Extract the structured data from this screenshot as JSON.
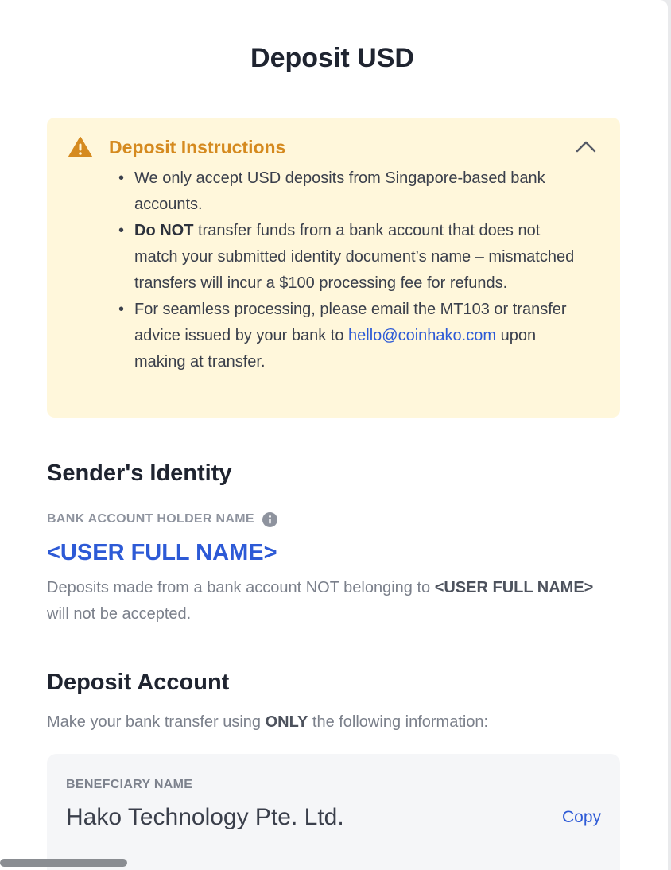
{
  "page": {
    "title": "Deposit USD"
  },
  "instructions": {
    "title": "Deposit Instructions",
    "warning_icon": "warning-triangle-icon",
    "collapse_icon": "chevron-up-icon",
    "bullet1": "We only accept USD deposits from Singapore-based bank accounts.",
    "bullet2_bold": "Do NOT",
    "bullet2_rest": " transfer funds from a bank account that does not match your submitted identity document’s name – mismatched transfers will incur a $100 processing fee for refunds.",
    "bullet3_start": "For seamless processing, please email the MT103 or transfer advice issued by your bank to ",
    "bullet3_link": "hello@coinhako.com",
    "bullet3_end": " upon making at transfer."
  },
  "sender": {
    "title": "Sender's Identity",
    "label": "BANK ACCOUNT HOLDER NAME",
    "info_icon": "info-icon",
    "name": "<USER FULL NAME>",
    "note_start": "Deposits made from a bank account NOT belonging to ",
    "note_bold": "<USER FULL NAME>",
    "note_end": " will not be accepted."
  },
  "deposit_account": {
    "title": "Deposit Account",
    "intro_start": "Make your bank transfer using ",
    "intro_bold": "ONLY",
    "intro_end": " the following information:",
    "beneficiary_label": "BENEFCIARY NAME",
    "beneficiary_value": "Hako Technology Pte. Ltd.",
    "copy_label": "Copy"
  },
  "colors": {
    "accent_blue": "#2d5ad6",
    "warning_orange": "#d58a1f",
    "notice_background": "#fff7db"
  }
}
